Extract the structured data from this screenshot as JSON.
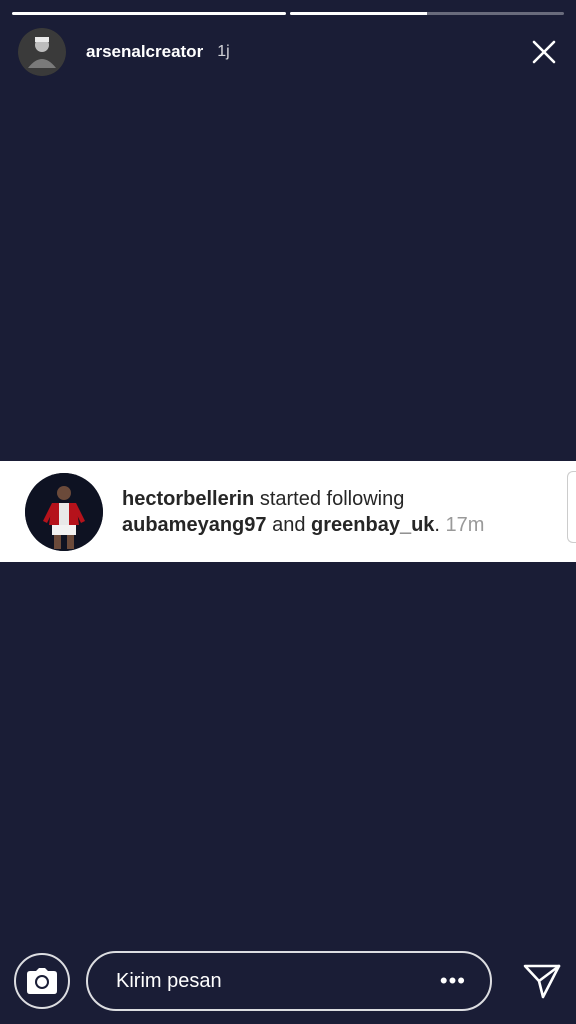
{
  "story": {
    "progress": [
      1.0,
      0.5
    ]
  },
  "header": {
    "username": "arsenalcreator",
    "time": "1j",
    "avatar_icon": "user-avatar",
    "close_icon": "close-icon"
  },
  "notification": {
    "actor": "hectorbellerin",
    "action": "started following",
    "target1": "aubameyang97",
    "conj": "and",
    "target2": "greenbay_uk",
    "period": ".",
    "time": "17m",
    "avatar_icon": "player-avatar"
  },
  "footer": {
    "camera_icon": "camera-icon",
    "message_placeholder": "Kirim pesan",
    "more_icon": "more-dots-icon",
    "more_label": "•••",
    "send_icon": "send-icon"
  },
  "colors": {
    "background": "#1a1d36",
    "card": "#ffffff",
    "text_dark": "#262626",
    "text_muted": "#999999"
  }
}
